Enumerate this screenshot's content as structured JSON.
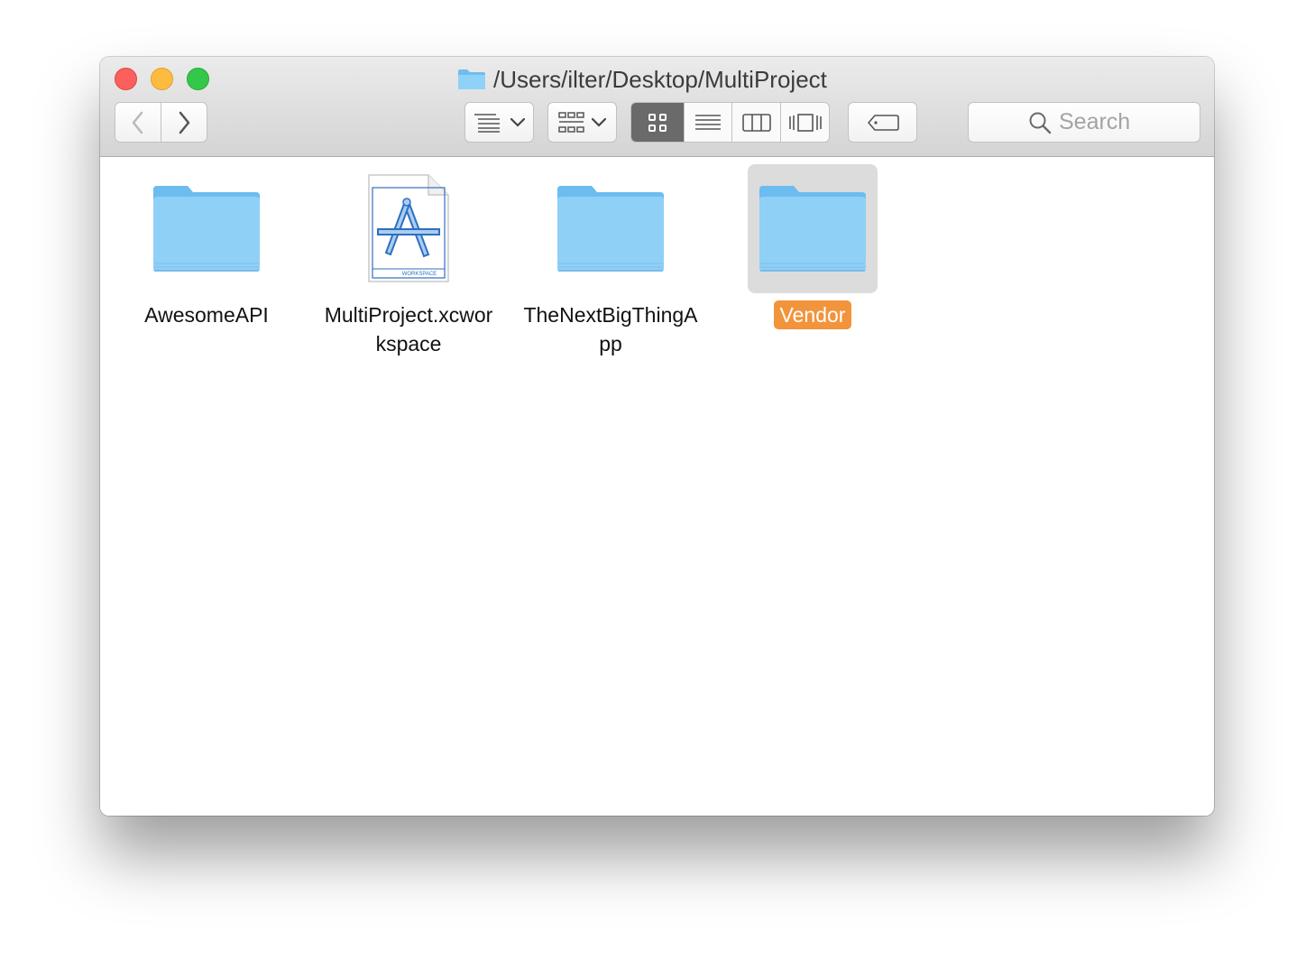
{
  "window": {
    "path_title": "/Users/ilter/Desktop/MultiProject"
  },
  "toolbar": {
    "back_icon": "chevron-left-icon",
    "forward_icon": "chevron-right-icon",
    "arrange_icon": "arrange-menu-icon",
    "group_icon": "group-grid-icon",
    "view_modes": [
      "icon-view",
      "list-view",
      "column-view",
      "cover-flow-view"
    ],
    "active_view": "icon-view",
    "tags_icon": "tag-icon"
  },
  "search": {
    "placeholder": "Search"
  },
  "items": [
    {
      "name": "AwesomeAPI",
      "kind": "folder",
      "selected": false
    },
    {
      "name": "MultiProject.xcworkspace",
      "kind": "xcode-workspace",
      "icon_caption": "WORKSPACE",
      "selected": false
    },
    {
      "name": "TheNextBigThingApp",
      "kind": "folder",
      "selected": false
    },
    {
      "name": "Vendor",
      "kind": "folder",
      "selected": true
    }
  ],
  "colors": {
    "selection_label": "#f2943c",
    "folder_blue": "#7cc8f5",
    "close": "#fc605c",
    "minimize": "#fdbc40",
    "maximize": "#34c84a"
  }
}
